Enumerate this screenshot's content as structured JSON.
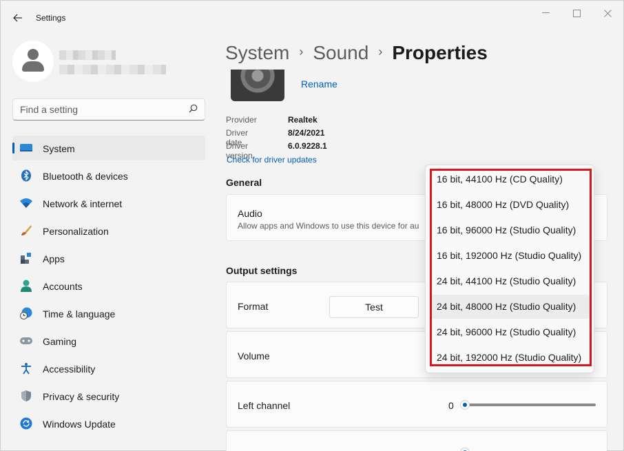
{
  "window": {
    "title": "Settings",
    "back_icon": "back-arrow-icon",
    "minimize_icon": "minimize-icon",
    "maximize_icon": "maximize-icon",
    "close_icon": "close-icon"
  },
  "sidebar": {
    "search": {
      "placeholder": "Find a setting",
      "icon": "search-icon"
    },
    "items": [
      {
        "label": "System",
        "icon": "monitor-icon",
        "selected": true
      },
      {
        "label": "Bluetooth & devices",
        "icon": "bluetooth-icon"
      },
      {
        "label": "Network & internet",
        "icon": "wifi-icon"
      },
      {
        "label": "Personalization",
        "icon": "brush-icon"
      },
      {
        "label": "Apps",
        "icon": "apps-icon"
      },
      {
        "label": "Accounts",
        "icon": "person-icon"
      },
      {
        "label": "Time & language",
        "icon": "globe-clock-icon"
      },
      {
        "label": "Gaming",
        "icon": "gamepad-icon"
      },
      {
        "label": "Accessibility",
        "icon": "accessibility-icon"
      },
      {
        "label": "Privacy & security",
        "icon": "shield-icon"
      },
      {
        "label": "Windows Update",
        "icon": "refresh-icon"
      }
    ]
  },
  "breadcrumb": {
    "parts": [
      "System",
      "Sound"
    ],
    "current": "Properties"
  },
  "device": {
    "rename_label": "Rename",
    "properties": [
      {
        "key": "Provider",
        "value": "Realtek"
      },
      {
        "key": "Driver date",
        "value": "8/24/2021"
      },
      {
        "key": "Driver version",
        "value": "6.0.9228.1"
      }
    ],
    "driver_link": "Check for driver updates"
  },
  "general": {
    "title": "General",
    "audio_title": "Audio",
    "audio_sub": "Allow apps and Windows to use this device for au"
  },
  "output": {
    "title": "Output settings",
    "format_label": "Format",
    "test_label": "Test",
    "volume_label": "Volume",
    "left_channel_label": "Left channel",
    "left_channel_value": "0"
  },
  "format_dropdown": {
    "options": [
      "16 bit, 44100 Hz (CD Quality)",
      "16 bit, 48000 Hz (DVD Quality)",
      "16 bit, 96000 Hz (Studio Quality)",
      "16 bit, 192000 Hz (Studio Quality)",
      "24 bit, 44100 Hz (Studio Quality)",
      "24 bit, 48000 Hz (Studio Quality)",
      "24 bit, 96000 Hz (Studio Quality)",
      "24 bit, 192000 Hz (Studio Quality)"
    ],
    "hovered_index": 5
  },
  "colors": {
    "accent": "#005fb8",
    "highlight": "#d9161c"
  }
}
